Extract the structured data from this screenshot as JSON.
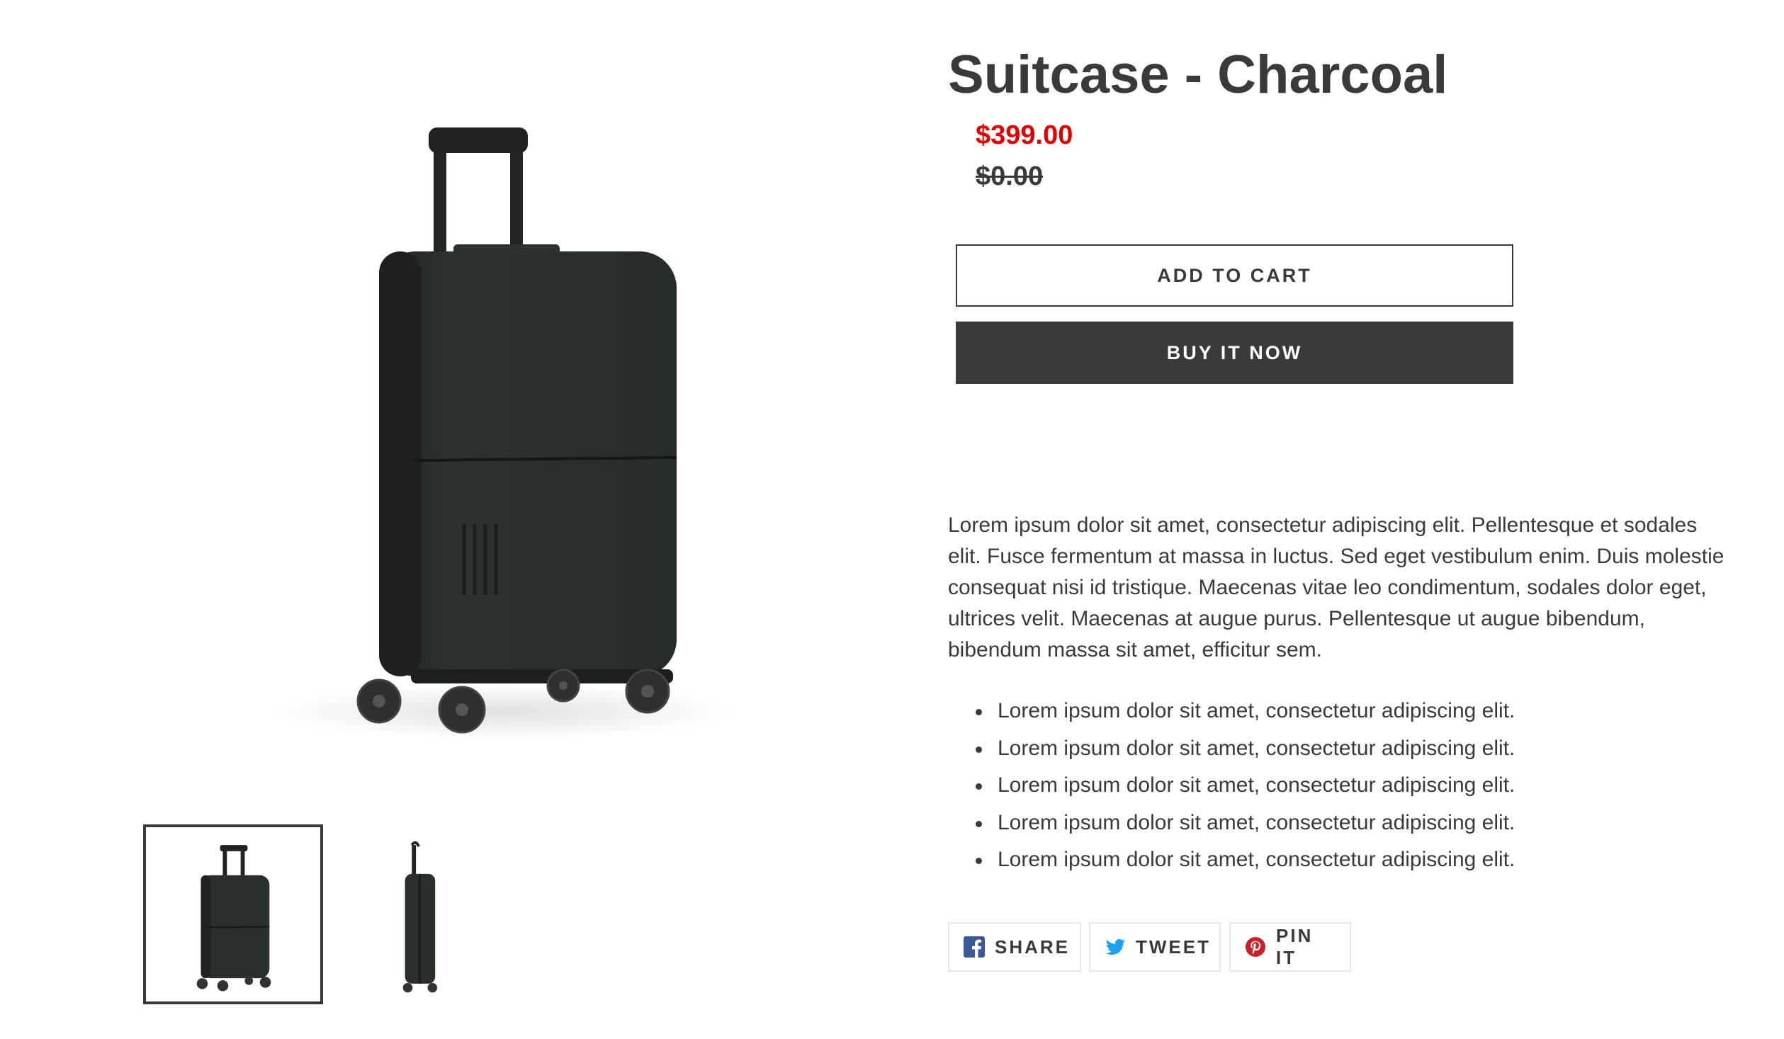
{
  "product": {
    "title": "Suitcase - Charcoal",
    "sale_price": "$399.00",
    "regular_price": "$0.00",
    "add_to_cart_label": "ADD TO CART",
    "buy_now_label": "BUY IT NOW",
    "description": "Lorem ipsum dolor sit amet, consectetur adipiscing elit. Pellentesque et sodales elit. Fusce fermentum at massa in luctus. Sed eget vestibulum enim. Duis molestie consequat nisi id tristique. Maecenas vitae leo condimentum, sodales dolor eget, ultrices velit. Maecenas at augue purus. Pellentesque ut augue bibendum, bibendum massa sit amet, efficitur sem.",
    "bullets": [
      "Lorem ipsum dolor sit amet, consectetur adipiscing elit.",
      "Lorem ipsum dolor sit amet, consectetur adipiscing elit.",
      "Lorem ipsum dolor sit amet, consectetur adipiscing elit.",
      "Lorem ipsum dolor sit amet, consectetur adipiscing elit.",
      "Lorem ipsum dolor sit amet, consectetur adipiscing elit."
    ]
  },
  "share": {
    "facebook_label": "SHARE",
    "twitter_label": "TWEET",
    "pinterest_label": "PIN IT"
  },
  "gallery": {
    "thumbnails": [
      "suitcase-front-view",
      "suitcase-side-view"
    ],
    "selected_index": 0
  },
  "colors": {
    "sale_price": "#e00000",
    "text": "#3a3a3a",
    "button_dark": "#3a3a3a",
    "facebook": "#3b5998",
    "twitter": "#1da1f2",
    "pinterest": "#cb2027"
  },
  "icons": [
    "facebook-icon",
    "twitter-icon",
    "pinterest-icon"
  ]
}
